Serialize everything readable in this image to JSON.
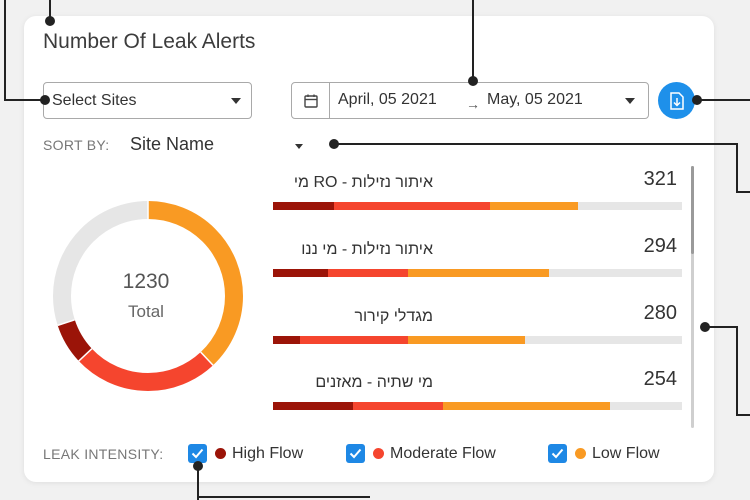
{
  "title": "Number Of Leak Alerts",
  "site_select": {
    "label": "Select Sites"
  },
  "date_range": {
    "start": "April, 05 2021",
    "end": "May, 05 2021",
    "arrow": "→"
  },
  "sort": {
    "label": "SORT BY:",
    "value": "Site Name"
  },
  "donut": {
    "total": "1230",
    "total_label": "Total"
  },
  "rows": [
    {
      "name": "איתור נזילות - RO מי",
      "count": "321",
      "high": 0.15,
      "moderate": 0.38,
      "low": 0.215
    },
    {
      "name": "איתור נזילות - מי ננו",
      "count": "294",
      "high": 0.135,
      "moderate": 0.195,
      "low": 0.345
    },
    {
      "name": "מגדלי קירור",
      "count": "280",
      "high": 0.065,
      "moderate": 0.265,
      "low": 0.285
    },
    {
      "name": "מי שתיה - מאזנים",
      "count": "254",
      "high": 0.195,
      "moderate": 0.22,
      "low": 0.41
    }
  ],
  "legend": {
    "label": "LEAK INTENSITY:",
    "high": "High Flow",
    "moderate": "Moderate Flow",
    "low": "Low Flow"
  },
  "colors": {
    "high": "#9b1408",
    "moderate": "#f5452e",
    "low": "#f99a23",
    "empty": "#e6e6e6",
    "accent": "#1e90ea"
  },
  "chart_data": {
    "type": "pie",
    "categories": [
      "High Flow",
      "Moderate Flow",
      "Low Flow",
      "Other"
    ],
    "values": [
      0.07,
      0.25,
      0.38,
      0.3
    ],
    "title": "",
    "total": 1230
  }
}
